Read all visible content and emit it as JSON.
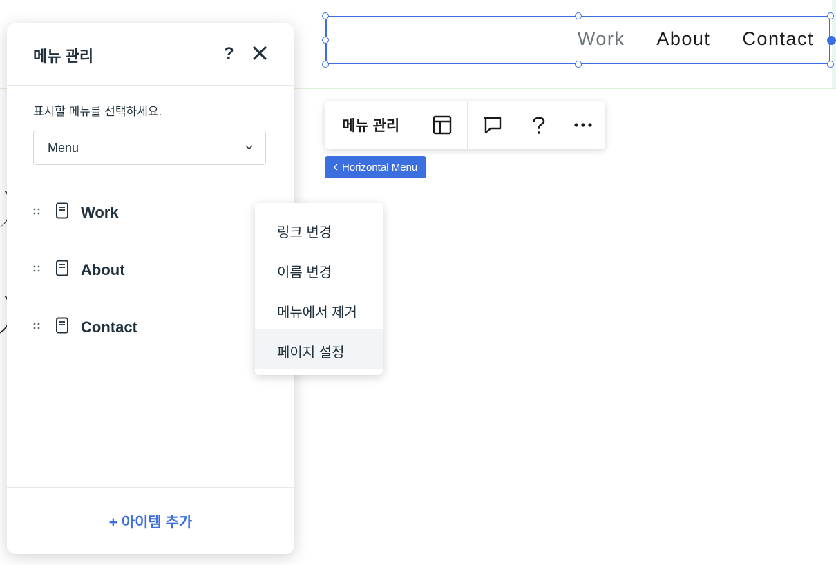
{
  "canvas": {
    "horizontal_menu": {
      "items": [
        {
          "label": "Work"
        },
        {
          "label": "About"
        },
        {
          "label": "Contact"
        }
      ]
    }
  },
  "toolbar": {
    "label": "메뉴 관리",
    "buttons": [
      "layout-icon",
      "comment-icon",
      "help-icon",
      "more-icon"
    ]
  },
  "breadcrumb": {
    "label": "Horizontal Menu"
  },
  "panel": {
    "title": "메뉴 관리",
    "help_label": "?",
    "instruction": "표시할 메뉴를 선택하세요.",
    "dropdown": {
      "value": "Menu"
    },
    "items": [
      {
        "label": "Work"
      },
      {
        "label": "About"
      },
      {
        "label": "Contact"
      }
    ],
    "add_item_label": "+ 아이템 추가"
  },
  "context_menu": {
    "items": [
      {
        "label": "링크 변경"
      },
      {
        "label": "이름 변경"
      },
      {
        "label": "메뉴에서 제거"
      },
      {
        "label": "페이지 설정"
      }
    ],
    "highlighted_index": 3
  },
  "colors": {
    "accent": "#3b6fe0",
    "text": "#20303c"
  }
}
